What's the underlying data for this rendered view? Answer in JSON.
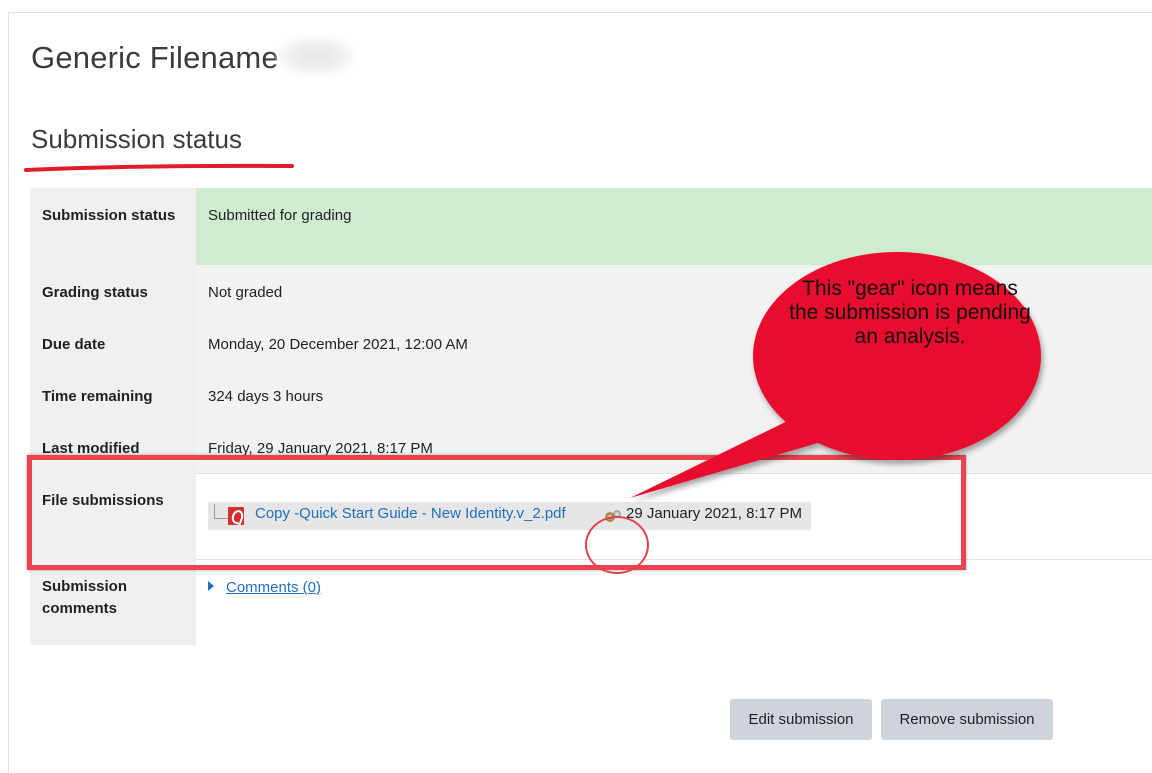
{
  "page": {
    "title": "Generic Filename",
    "section_title": "Submission status"
  },
  "status_rows": [
    {
      "label": "Submission status",
      "value": "Submitted for grading"
    },
    {
      "label": "Grading status",
      "value": "Not graded"
    },
    {
      "label": "Due date",
      "value": "Monday, 20 December 2021, 12:00 AM"
    },
    {
      "label": "Time remaining",
      "value": "324 days 3 hours"
    },
    {
      "label": "Last modified",
      "value": "Friday, 29 January 2021, 8:17 PM"
    },
    {
      "label": "File submissions",
      "file_name": "Copy -Quick Start Guide - New Identity.v_2.pdf",
      "file_date": "29 January 2021, 8:17 PM",
      "file_icon": "pdf-icon",
      "status_icon": "gear-icon"
    },
    {
      "label": "Submission comments",
      "value": "Comments (0)"
    }
  ],
  "callout": {
    "text": "This \"gear\" icon means the submission is pending an analysis."
  },
  "actions": {
    "edit_label": "Edit submission",
    "remove_label": "Remove submission"
  },
  "colors": {
    "submitted_bg": "#cfeccf",
    "link": "#1f6fbe",
    "annotation_red": "#e8434f",
    "callout_fill": "#e8112d",
    "button_bg": "#ced4da"
  }
}
